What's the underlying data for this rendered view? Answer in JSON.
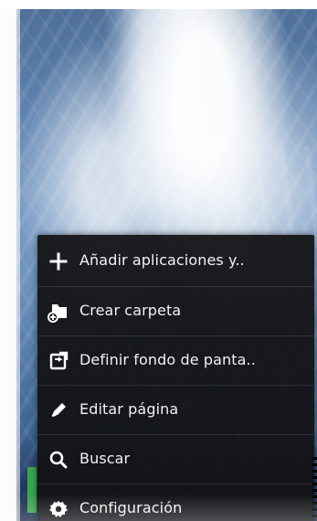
{
  "menu": {
    "items": [
      {
        "label": "Añadir aplicaciones y..",
        "icon": "plus-icon"
      },
      {
        "label": "Crear carpeta",
        "icon": "folder-add-icon"
      },
      {
        "label": "Definir fondo de panta..",
        "icon": "wallpaper-icon"
      },
      {
        "label": "Editar página",
        "icon": "pencil-icon"
      },
      {
        "label": "Buscar",
        "icon": "search-icon"
      },
      {
        "label": "Configuración",
        "icon": "gear-icon"
      }
    ]
  },
  "colors": {
    "menu_background": "#121214",
    "menu_text": "#f2f2f2",
    "accent_green": "#36a94a"
  }
}
